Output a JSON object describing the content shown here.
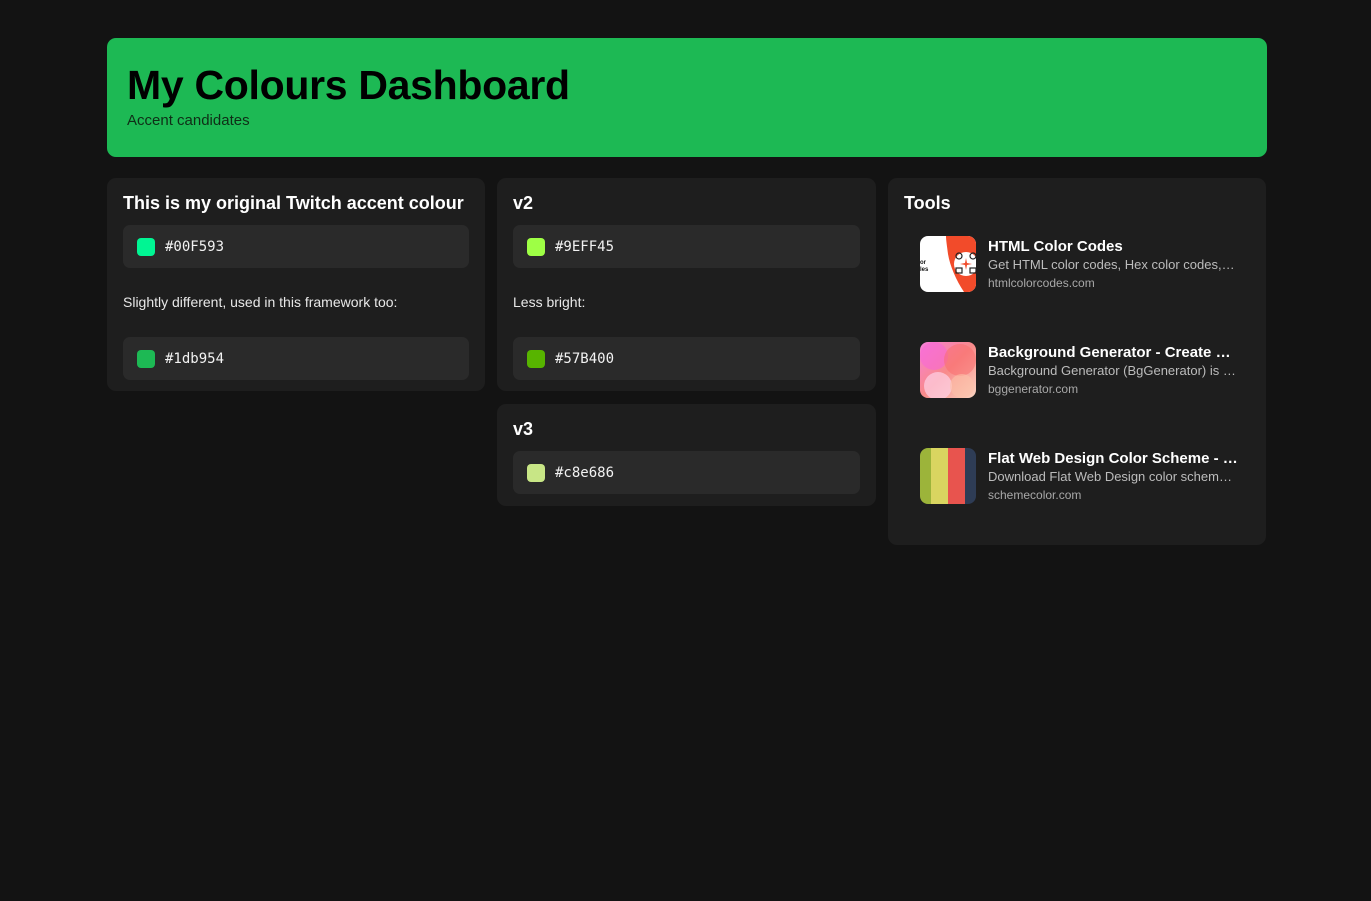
{
  "header": {
    "title": "My Colours Dashboard",
    "subtitle": "Accent candidates",
    "color": "#1db954"
  },
  "cards": {
    "original": {
      "title": "This is my original Twitch accent colour",
      "swatch1": {
        "code": "#00F593",
        "color": "#00F593"
      },
      "note": "Slightly different, used in this framework too:",
      "swatch2": {
        "code": "#1db954",
        "color": "#1db954"
      }
    },
    "v2": {
      "title": "v2",
      "swatch1": {
        "code": "#9EFF45",
        "color": "#9EFF45"
      },
      "note": "Less bright:",
      "swatch2": {
        "code": "#57B400",
        "color": "#57B400"
      }
    },
    "v3": {
      "title": "v3",
      "swatch1": {
        "code": "#c8e686",
        "color": "#c8e686"
      }
    }
  },
  "tools": {
    "title": "Tools",
    "items": [
      {
        "title": "HTML Color Codes",
        "desc": "Get HTML color codes, Hex color codes, RGB and HSL values",
        "domain": "htmlcolorcodes.com",
        "icon": "htmlcolorcodes-thumbnail"
      },
      {
        "title": "Background Generator - Create beautiful backgrounds",
        "desc": "Background Generator (BgGenerator) is a free tool",
        "domain": "bggenerator.com",
        "icon": "bggenerator-thumbnail"
      },
      {
        "title": "Flat Web Design Color Scheme - Palette",
        "desc": "Download Flat Web Design color scheme consisting of",
        "domain": "schemecolor.com",
        "icon": "schemecolor-thumbnail"
      }
    ]
  }
}
